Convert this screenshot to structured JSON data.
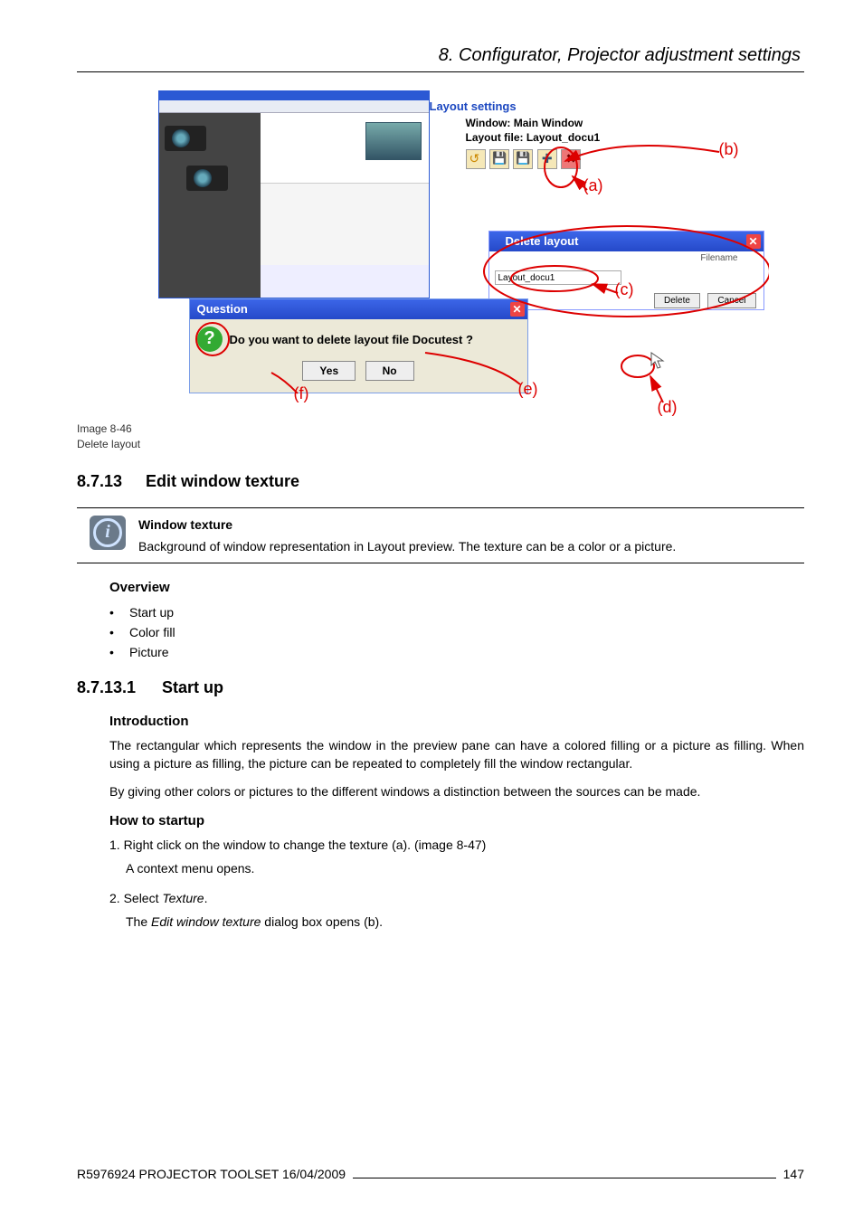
{
  "header": {
    "chapter": "8.  Configurator, Projector adjustment settings"
  },
  "figure": {
    "caption_id": "Image 8-46",
    "caption_text": "Delete layout",
    "layout_settings_title": "Layout settings",
    "window_label": "Window:  Main Window",
    "layoutfile_label": "Layout file:  Layout_docu1",
    "delete_dialog_title": "Delete layout",
    "delete_filename_header": "Filename",
    "delete_filename_value": "Layout_docu1",
    "delete_btn_delete": "Delete",
    "delete_btn_cancel": "Cancel",
    "question_title": "Question",
    "question_text": "Do you want to delete layout file Docutest ?",
    "question_yes": "Yes",
    "question_no": "No",
    "anno_a": "(a)",
    "anno_b": "(b)",
    "anno_c": "(c)",
    "anno_d": "(d)",
    "anno_e": "(e)",
    "anno_f": "(f)"
  },
  "section_8_7_13": {
    "num": "8.7.13",
    "title": "Edit window texture"
  },
  "info": {
    "title": "Window texture",
    "body": "Background of window representation in Layout preview. The texture can be a color or a picture."
  },
  "overview": {
    "heading": "Overview",
    "items": [
      "Start up",
      "Color fill",
      "Picture"
    ]
  },
  "section_8_7_13_1": {
    "num": "8.7.13.1",
    "title": "Start up"
  },
  "intro": {
    "heading": "Introduction",
    "p1": "The rectangular which represents the window in the preview pane can have a colored filling or a picture as filling.  When using a picture as filling, the picture can be repeated to completely fill the window rectangular.",
    "p2": "By giving other colors or pictures to the different windows a distinction between the sources can be made."
  },
  "howto": {
    "heading": "How to startup",
    "step1": "1. Right click on the window to change the texture (a).  (image 8-47)",
    "step1_sub": "A context menu opens.",
    "step2_pre": "2. Select ",
    "step2_ital": "Texture",
    "step2_post": ".",
    "step2_sub_pre": "The ",
    "step2_sub_ital": "Edit window texture",
    "step2_sub_post": " dialog box opens (b)."
  },
  "footer": {
    "left": "R5976924   PROJECTOR TOOLSET   16/04/2009",
    "page": "147"
  }
}
